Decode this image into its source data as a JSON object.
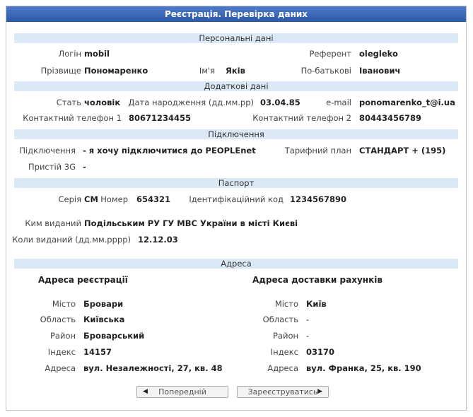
{
  "title": "Реєстрація. Перевірка даних",
  "sections": {
    "personal": "Персональні дані",
    "additional": "Додаткові дані",
    "connection": "Підключення",
    "passport": "Паспорт",
    "address": "Адреса"
  },
  "personal": {
    "login_label": "Логін",
    "login": "mobil",
    "referent_label": "Референт",
    "referent": "olegleko",
    "surname_label": "Прізвище",
    "surname": "Пономаренко",
    "name_label": "Ім'я",
    "name": "Яків",
    "patronymic_label": "По-батькові",
    "patronymic": "Іванович"
  },
  "additional": {
    "sex_label": "Стать",
    "sex": "чоловік",
    "dob_label": "Дата народження (дд.мм.рр)",
    "dob": "03.04.85",
    "email_label": "e-mail",
    "email": "ponomarenko_t@i.ua",
    "phone1_label": "Контактний телефон 1",
    "phone1": "80671234455",
    "phone2_label": "Контактний телефон 2",
    "phone2": "80443456789"
  },
  "connection": {
    "connection_label": "Підключення",
    "connection": "- я хочу підключитися до PEOPLEnet",
    "tariff_label": "Тарифний план",
    "tariff": "СТАНДАРТ + (195)",
    "device_label": "Пристій 3G",
    "device": "-"
  },
  "passport": {
    "series_label": "Серія",
    "series": "СМ",
    "number_label": "Номер",
    "number": "654321",
    "tax_label": "Ідентифікаційний код",
    "tax": "1234567890",
    "issued_by_label": "Ким виданий",
    "issued_by": "Подільським РУ ГУ МВС України в місті Києві",
    "issued_date_label": "Коли виданий (дд.мм.рррр)",
    "issued_date": "12.12.03"
  },
  "address": {
    "reg_title": "Адреса реєстрації",
    "del_title": "Адреса доставки рахунків",
    "city_label": "Місто",
    "region_label": "Область",
    "district_label": "Район",
    "index_label": "Індекс",
    "addr_label": "Адреса",
    "reg": {
      "city": "Бровари",
      "region": "Київська",
      "district": "Броварський",
      "index": "14157",
      "addr": "вул. Незалежності, 27, кв. 48"
    },
    "del": {
      "city": "Київ",
      "region": "-",
      "district": "-",
      "index": "03170",
      "addr": "вул. Франка, 25, кв. 190"
    }
  },
  "buttons": {
    "prev": "Попередній",
    "register": "Зареєструватись"
  }
}
